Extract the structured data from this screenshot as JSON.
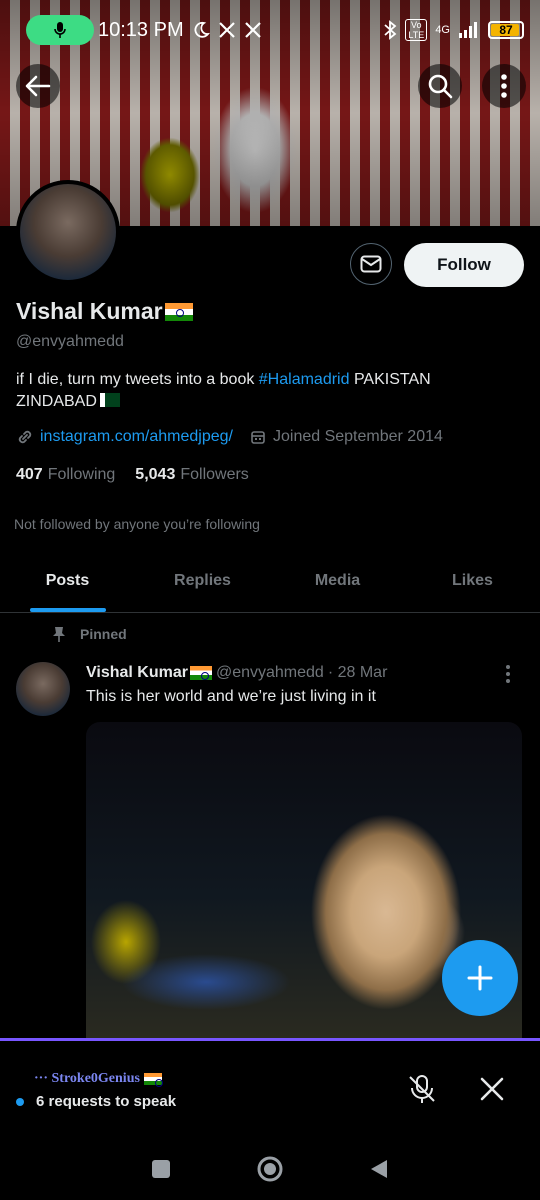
{
  "status_bar": {
    "time": "10:13 PM",
    "network": "4G",
    "volte": "Vo LTE",
    "battery": "87",
    "battery_level": 0.87
  },
  "profile": {
    "name": "Vishal Kumar",
    "handle": "@envyahmedd",
    "bio_text": "if I die, turn my tweets into a book ",
    "bio_hashtag": "#Halamadrid",
    "bio_rest": " PAKISTAN ZINDABAD",
    "link": "instagram.com/ahmedjpeg/",
    "joined": "Joined September 2014",
    "following_count": "407",
    "following_label": "Following",
    "followers_count": "5,043",
    "followers_label": "Followers",
    "not_followed": "Not followed by anyone you’re following"
  },
  "actions": {
    "follow_label": "Follow"
  },
  "tabs": [
    {
      "label": "Posts",
      "active": true
    },
    {
      "label": "Replies",
      "active": false
    },
    {
      "label": "Media",
      "active": false
    },
    {
      "label": "Likes",
      "active": false
    }
  ],
  "pinned_post": {
    "pinned_label": "Pinned",
    "author": "Vishal Kumar",
    "handle": "@envyahmedd",
    "date": "· 28 Mar",
    "text": "This is her world and we’re just living in it"
  },
  "space": {
    "host": "··· Stroke0Genius",
    "requests": "6 requests to speak"
  },
  "colors": {
    "accent": "#1d9bf0",
    "space_border": "#7856ff",
    "mic_pill": "#3ddc84",
    "battery": "#f4b400"
  },
  "icons": [
    "mic-icon",
    "moon-icon",
    "x-logo-icon",
    "bluetooth-icon",
    "signal-icon",
    "back-arrow-icon",
    "search-icon",
    "more-vertical-icon",
    "mail-icon",
    "link-icon",
    "calendar-icon",
    "pin-icon",
    "plus-icon",
    "mic-off-icon",
    "close-icon",
    "recents-icon",
    "home-icon",
    "back-icon"
  ]
}
